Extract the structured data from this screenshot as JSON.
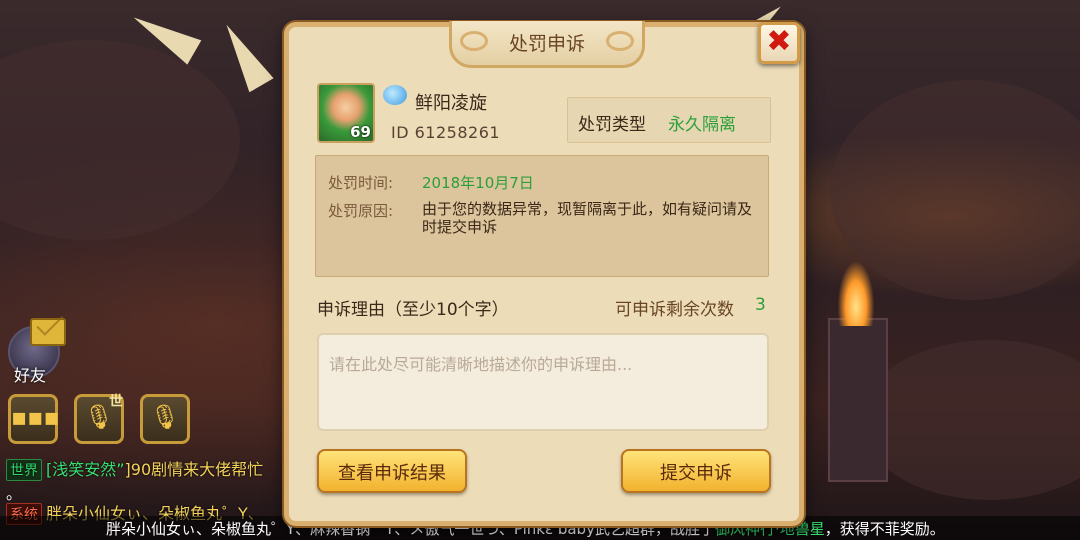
{
  "hud": {
    "friends_label": "好友",
    "voice_world_tag": "世"
  },
  "chat": {
    "line1_channel": "世界",
    "line1_sender": "[浅笑安然”",
    "line1_text": "]90剧情来大佬帮忙",
    "line1_tail": "。",
    "line2_channel": "系统",
    "line2_text": "胖朵小仙女ぃ、朵椒鱼丸゜Y、",
    "ticker_prefix": "胖朵小仙女ぃ、朵椒鱼丸゜Y、麻辣香锅゜Y、メ傲气一世づ、Pinkε baby武艺超群，战胜了",
    "ticker_highlight": "御风神行·地兽星",
    "ticker_suffix": "，获得不菲奖励。"
  },
  "dialog": {
    "title": "处罚申诉",
    "close_symbol": "✖",
    "player": {
      "name": "鲜阳凌旋",
      "id_text": "ID 61258261",
      "level": "69"
    },
    "penalty_type_label": "处罚类型",
    "penalty_type_value": "永久隔离",
    "penalty_time_label": "处罚时间:",
    "penalty_time_value": "2018年10月7日",
    "penalty_reason_label": "处罚原因:",
    "penalty_reason_value": "由于您的数据异常，现暂隔离于此，如有疑问请及时提交申诉",
    "appeal_reason_label": "申诉理由（至少10个字）",
    "remaining_label": "可申诉剩余次数",
    "remaining_count": "3",
    "appeal_placeholder": "请在此处尽可能清晰地描述你的申诉理由...",
    "view_result_button": "查看申诉结果",
    "submit_button": "提交申诉"
  },
  "colors": {
    "accent_green": "#2ba03a",
    "close_red": "#d01a10",
    "button_gold": "#f2b22e"
  }
}
